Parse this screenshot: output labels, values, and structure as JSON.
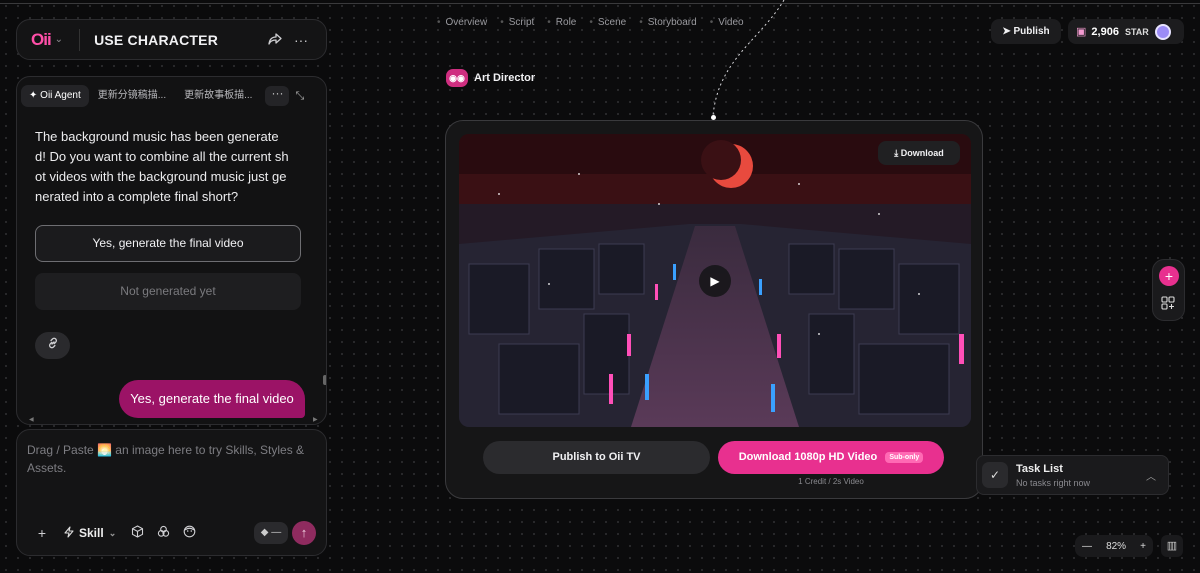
{
  "header": {
    "logo": "Oii",
    "project_title": "USE CHARACTER"
  },
  "steps": [
    "Overview",
    "Script",
    "Role",
    "Scene",
    "Storyboard",
    "Video"
  ],
  "topbar": {
    "publish_label": "Publish",
    "star_count": "2,906",
    "star_label": "STAR"
  },
  "chat": {
    "tabs": [
      "Oii Agent",
      "更新分镜稿描...",
      "更新故事板描..."
    ],
    "assistant_message": "The background music has been generated! Do you want to combine all the current shot videos with the background music just generated into a complete final short?",
    "option_confirm": "Yes, generate the final video",
    "option_disabled": "Not generated yet",
    "user_message": "Yes, generate the final video"
  },
  "input": {
    "placeholder": "Drag / Paste 🌅 an image here to try Skills, Styles & Assets.",
    "skill_label": "Skill",
    "credit_value": "—"
  },
  "card": {
    "node_label": "Art Director",
    "download_label": "Download",
    "publish_tv_label": "Publish to Oii TV",
    "download_hd_label": "Download 1080p HD Video",
    "sub_badge": "Sub-only",
    "credit_note": "1 Credit / 2s Video"
  },
  "tasks": {
    "title": "Task List",
    "subtitle": "No tasks right now"
  },
  "zoom": {
    "level": "82%"
  },
  "colors": {
    "accent": "#e8308f",
    "user_bubble": "#9b1366"
  }
}
